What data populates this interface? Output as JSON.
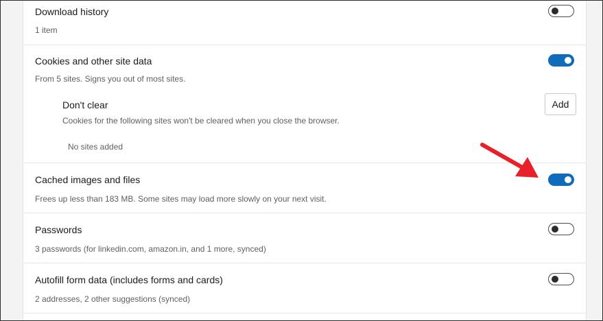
{
  "settings": [
    {
      "title": "Download history",
      "desc": "1 item",
      "toggle": "off"
    },
    {
      "title": "Cookies and other site data",
      "desc": "From 5 sites. Signs you out of most sites.",
      "toggle": "on"
    },
    {
      "title": "Cached images and files",
      "desc": "Frees up less than 183 MB. Some sites may load more slowly on your next visit.",
      "toggle": "on"
    },
    {
      "title": "Passwords",
      "desc": "3 passwords (for linkedin.com, amazon.in, and 1 more, synced)",
      "toggle": "off"
    },
    {
      "title": "Autofill form data (includes forms and cards)",
      "desc": "2 addresses, 2 other suggestions (synced)",
      "toggle": "off"
    }
  ],
  "dont_clear": {
    "title": "Don't clear",
    "desc": "Cookies for the following sites won't be cleared when you close the browser.",
    "add_label": "Add",
    "empty_text": "No sites added"
  },
  "colors": {
    "accent": "#0f6cbd",
    "annotation_arrow": "#e8202a"
  },
  "icons": {
    "annotation": "red-arrow-icon"
  }
}
